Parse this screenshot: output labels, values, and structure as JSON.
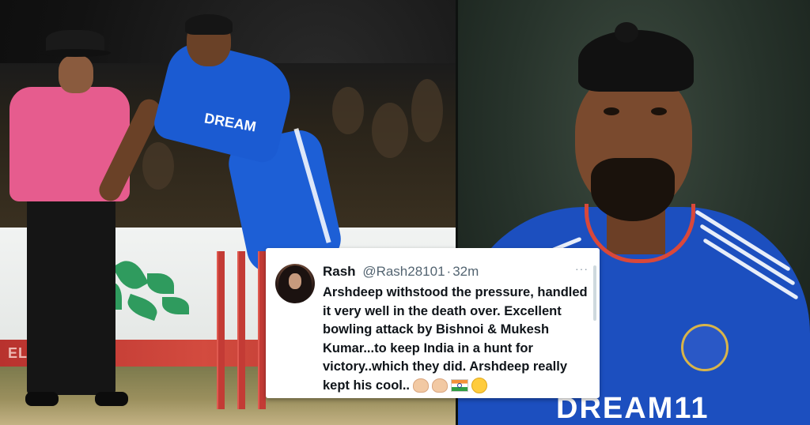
{
  "tweet": {
    "name": "Rash",
    "handle": "@Rash28101",
    "separator": "·",
    "time": "32m",
    "more": "···",
    "text": "Arshdeep withstood the pressure, handled it very well in the death over. Excellent bowling attack  by Bishnoi & Mukesh Kumar...to keep India in a hunt for victory..which they did. Arshdeep really kept his cool..",
    "emojis": [
      "clapping-hands-icon",
      "clapping-hands-icon",
      "india-flag-icon",
      "party-face-icon"
    ]
  },
  "left_photo": {
    "sponsor_board_text": "ELAURE",
    "jersey_text": "DREAM"
  },
  "right_photo": {
    "jersey_text": "DREAM11"
  },
  "colors": {
    "jersey_blue": "#1c4fbf",
    "umpire_pink": "#e65c8e",
    "stumps_red": "#c33b35"
  }
}
